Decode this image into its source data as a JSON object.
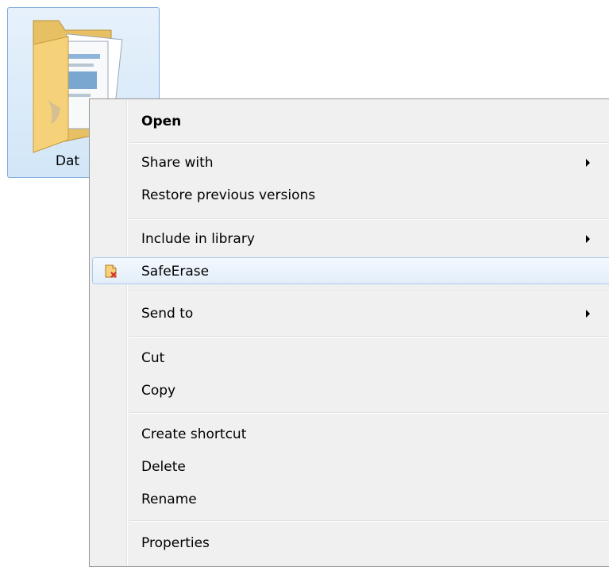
{
  "desktop": {
    "folder_label": "Dat"
  },
  "menu": {
    "open": "Open",
    "share_with": "Share with",
    "restore_previous_versions": "Restore previous versions",
    "include_in_library": "Include in library",
    "safeerase": "SafeErase",
    "send_to": "Send to",
    "cut": "Cut",
    "copy": "Copy",
    "create_shortcut": "Create shortcut",
    "delete": "Delete",
    "rename": "Rename",
    "properties": "Properties"
  },
  "icons": {
    "folder": "folder-icon",
    "safeerase": "safeerase-icon",
    "submenu": "chevron-right-icon"
  },
  "colors": {
    "menu_background": "#f0f0f0",
    "highlight_border": "#a8c9ee",
    "folder_selection": "#cce4f7"
  }
}
